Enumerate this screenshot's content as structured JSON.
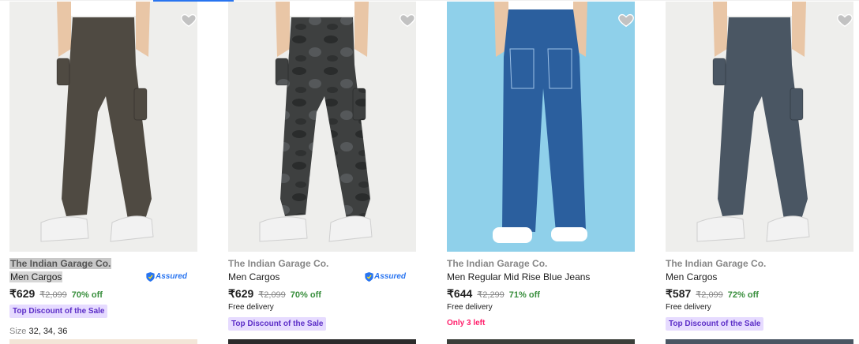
{
  "products": [
    {
      "brand": "The Indian Garage Co.",
      "title": "Men Cargos",
      "assured": true,
      "assured_label": "Assured",
      "price": "₹629",
      "mrp": "₹2,099",
      "discount": "70% off",
      "free_delivery": "",
      "badge": "Top Discount of the Sale",
      "stock_note": "",
      "size_label": "Size",
      "sizes": "32, 34, 36",
      "pant_color": "#4f4a42",
      "bg_color": "#eeeeec",
      "pattern": "solid"
    },
    {
      "brand": "The Indian Garage Co.",
      "title": "Men Cargos",
      "assured": true,
      "assured_label": "Assured",
      "price": "₹629",
      "mrp": "₹2,099",
      "discount": "70% off",
      "free_delivery": "Free delivery",
      "badge": "Top Discount of the Sale",
      "stock_note": "",
      "size_label": "",
      "sizes": "",
      "pant_color": "#3e4040",
      "bg_color": "#eeeeec",
      "pattern": "camo"
    },
    {
      "brand": "The Indian Garage Co.",
      "title": "Men Regular Mid Rise Blue Jeans",
      "assured": false,
      "assured_label": "",
      "price": "₹644",
      "mrp": "₹2,299",
      "discount": "71% off",
      "free_delivery": "Free delivery",
      "badge": "",
      "stock_note": "Only 3 left",
      "size_label": "",
      "sizes": "",
      "pant_color": "#2b5f9e",
      "bg_color": "#8fd0ea",
      "pattern": "denim"
    },
    {
      "brand": "The Indian Garage Co.",
      "title": "Men Cargos",
      "assured": false,
      "assured_label": "",
      "price": "₹587",
      "mrp": "₹2,099",
      "discount": "72% off",
      "free_delivery": "Free delivery",
      "badge": "Top Discount of the Sale",
      "stock_note": "",
      "size_label": "",
      "sizes": "",
      "pant_color": "#4a5663",
      "bg_color": "#eeeeec",
      "pattern": "solid"
    }
  ],
  "next_row_colors": [
    "#f3e6d8",
    "#2c2c2c",
    "#3b3f3a",
    "#4a5663"
  ],
  "icons": {
    "wishlist": "heart-icon",
    "assured": "assured-shield-icon"
  }
}
